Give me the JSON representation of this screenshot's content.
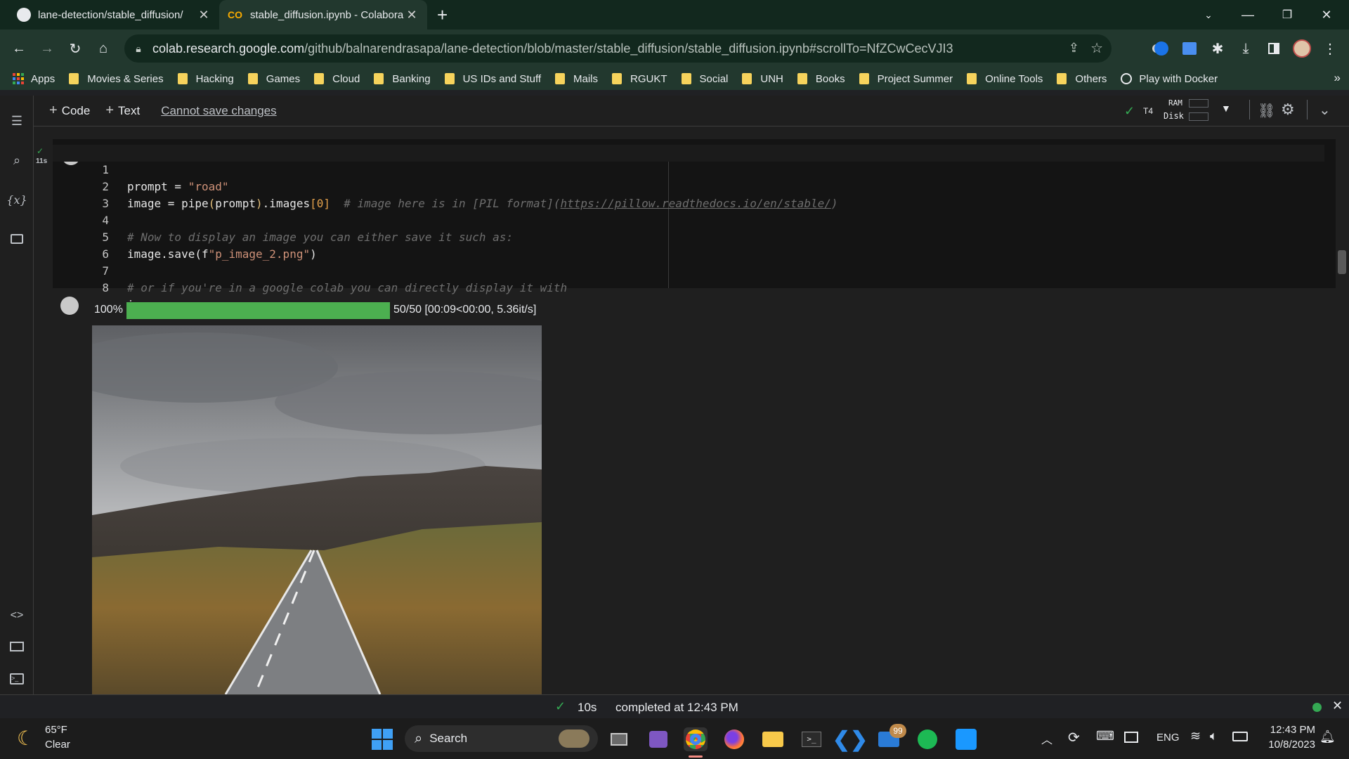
{
  "browser": {
    "tabs": [
      {
        "title": "lane-detection/stable_diffusion/",
        "icon": "github-icon",
        "active": false
      },
      {
        "title": "stable_diffusion.ipynb - Colabora",
        "icon": "colab-icon",
        "active": true
      }
    ],
    "url_domain": "colab.research.google.com",
    "url_path": "/github/balnarendrasapa/lane-detection/blob/master/stable_diffusion/stable_diffusion.ipynb#scrollTo=NfZCwCecVJI3"
  },
  "bookmarks": {
    "apps": "Apps",
    "folders": [
      "Movies & Series",
      "Hacking",
      "Games",
      "Cloud",
      "Banking",
      "US IDs and Stuff",
      "Mails",
      "RGUKT",
      "Social",
      "UNH",
      "Books",
      "Project Summer",
      "Online Tools",
      "Others"
    ],
    "play": "Play with Docker",
    "more": "»"
  },
  "colab": {
    "add_code": "Code",
    "add_text": "Text",
    "cannot_save": "Cannot save changes",
    "runtime": "T4",
    "ram_label": "RAM",
    "disk_label": "Disk"
  },
  "cell": {
    "exec_time": "11s",
    "lines": [
      {
        "n": "1"
      },
      {
        "n": "2"
      },
      {
        "n": "3"
      },
      {
        "n": "4"
      },
      {
        "n": "5"
      },
      {
        "n": "6"
      },
      {
        "n": "7"
      },
      {
        "n": "8"
      }
    ],
    "code": {
      "l1_a": "prompt = ",
      "l1_b": "\"road\"",
      "l2_a": "image = pipe",
      "l2_b": "(",
      "l2_c": "prompt",
      "l2_d": ")",
      "l2_e": ".images",
      "l2_f": "[0]",
      "l2_g": "  # image here is in [PIL format](",
      "l2_h": "https://pillow.readthedocs.io/en/stable/",
      "l2_i": ")",
      "l4": "# Now to display an image you can either save it such as:",
      "l5_a": "image.save(f",
      "l5_b": "\"p_image_2.png\"",
      "l5_c": ")",
      "l7": "# or if you're in a google colab you can directly display it with",
      "l8": "image"
    }
  },
  "output": {
    "progress_pct": "100%",
    "progress_value": 1.0,
    "progress_text": "50/50 [00:09<00:00, 5.36it/s]"
  },
  "status": {
    "duration": "10s",
    "completed": "completed at 12:43 PM"
  },
  "taskbar": {
    "weather_temp": "65°F",
    "weather_desc": "Clear",
    "search": "Search",
    "mail_badge": "99",
    "lang": "ENG",
    "time": "12:43 PM",
    "date": "10/8/2023"
  }
}
